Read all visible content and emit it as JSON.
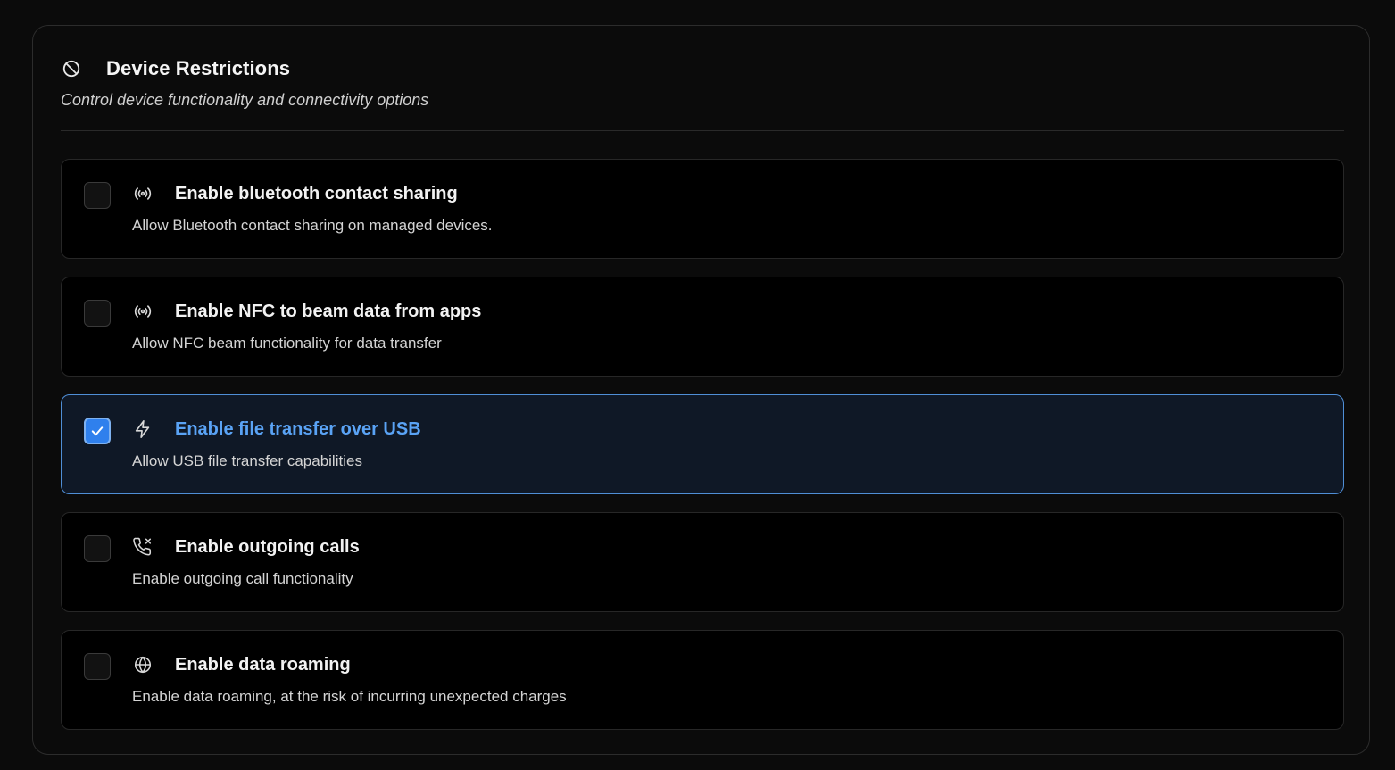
{
  "panel": {
    "title": "Device Restrictions",
    "subtitle": "Control device functionality and connectivity options",
    "icon": "ban-icon"
  },
  "options": [
    {
      "title": "Enable bluetooth contact sharing",
      "description": "Allow Bluetooth contact sharing on managed devices.",
      "icon": "radio-waves-icon",
      "checked": false
    },
    {
      "title": "Enable NFC to beam data from apps",
      "description": "Allow NFC beam functionality for data transfer",
      "icon": "radio-waves-icon",
      "checked": false
    },
    {
      "title": "Enable file transfer over USB",
      "description": "Allow USB file transfer capabilities",
      "icon": "lightning-icon",
      "checked": true
    },
    {
      "title": "Enable outgoing calls",
      "description": "Enable outgoing call functionality",
      "icon": "phone-missed-icon",
      "checked": false
    },
    {
      "title": "Enable data roaming",
      "description": "Enable data roaming, at the risk of incurring unexpected charges",
      "icon": "globe-icon",
      "checked": false
    }
  ],
  "colors": {
    "accent": "#2f80ed",
    "accent_text": "#5aa3f5",
    "background": "#0b0b0b"
  }
}
